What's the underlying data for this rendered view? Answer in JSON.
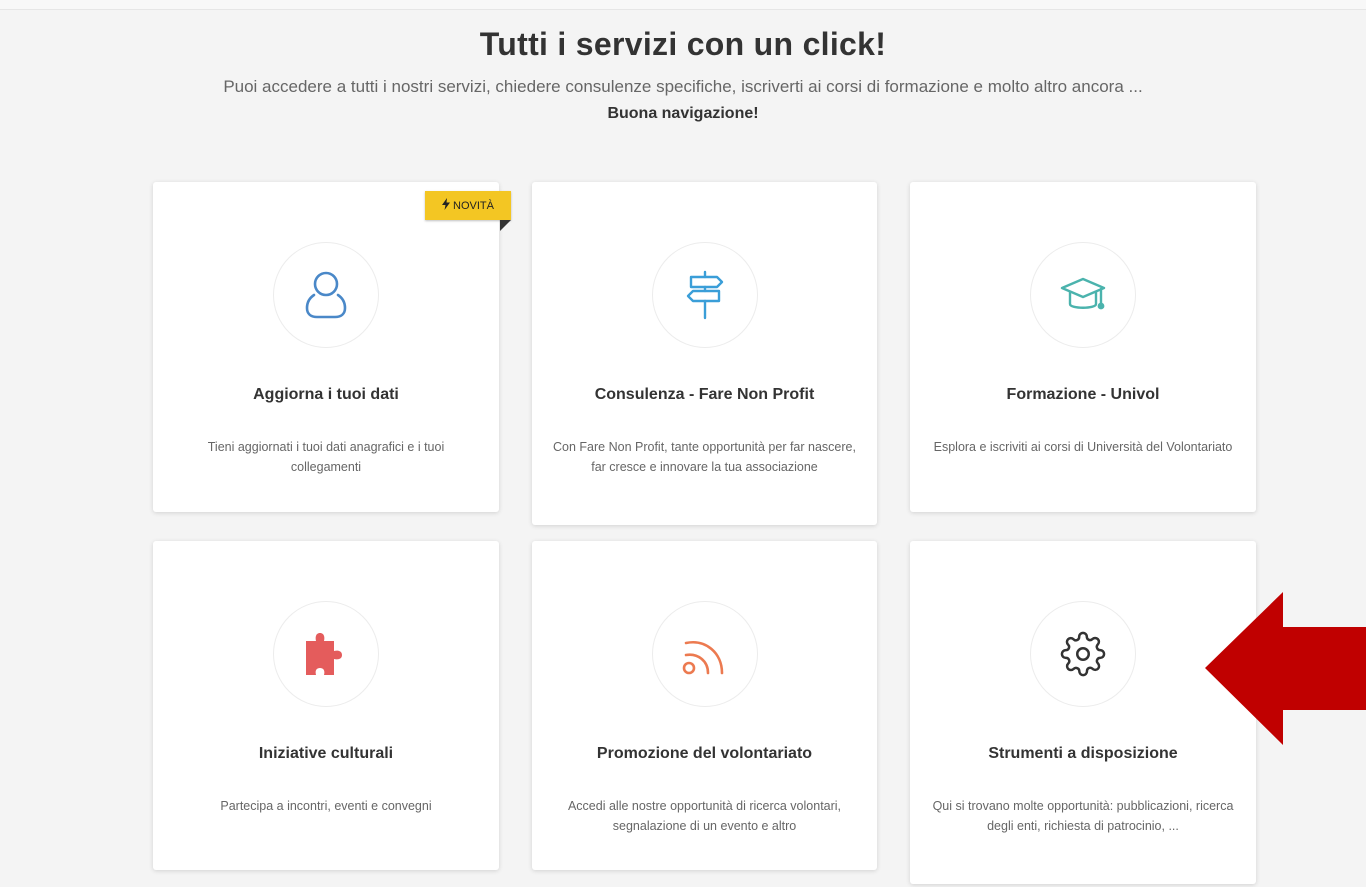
{
  "header": {
    "title": "Tutti i servizi con un click!",
    "subtitle": "Puoi accedere a tutti i nostri servizi, chiedere consulenze specifiche, iscriverti ai corsi di formazione e molto altro ancora ...",
    "subtitle_bold": "Buona navigazione!"
  },
  "badge": {
    "label": "NOVITÀ",
    "icon": "lightning-icon",
    "color": "#f3c623"
  },
  "cards": [
    {
      "title": "Aggiorna i tuoi dati",
      "desc": "Tieni aggiornati i tuoi dati anagrafici e i tuoi collegamenti",
      "icon": "user-icon",
      "color": "#4a88c8"
    },
    {
      "title": "Consulenza - Fare Non Profit",
      "desc": "Con Fare Non Profit, tante opportunità per far nascere, far cresce e innovare la tua associazione",
      "icon": "signpost-icon",
      "color": "#3a9ed8"
    },
    {
      "title": "Formazione - Univol",
      "desc": "Esplora e iscriviti ai corsi di Università del Volontariato",
      "icon": "graduation-cap-icon",
      "color": "#4bb3ad"
    },
    {
      "title": "Iniziative culturali",
      "desc": "Partecipa a incontri, eventi e convegni",
      "icon": "puzzle-icon",
      "color": "#e45c5c"
    },
    {
      "title": "Promozione del volontariato",
      "desc": "Accedi alle nostre opportunità di ricerca volontari, segnalazione di un evento e altro",
      "icon": "rss-icon",
      "color": "#ec7a50"
    },
    {
      "title": "Strumenti a disposizione",
      "desc": "Qui si trovano molte opportunità: pubblicazioni, ricerca degli enti, richiesta di patrocinio, ...",
      "icon": "gear-icon",
      "color": "#333333"
    }
  ],
  "arrow": {
    "icon": "left-arrow-icon",
    "color": "#c00000"
  }
}
